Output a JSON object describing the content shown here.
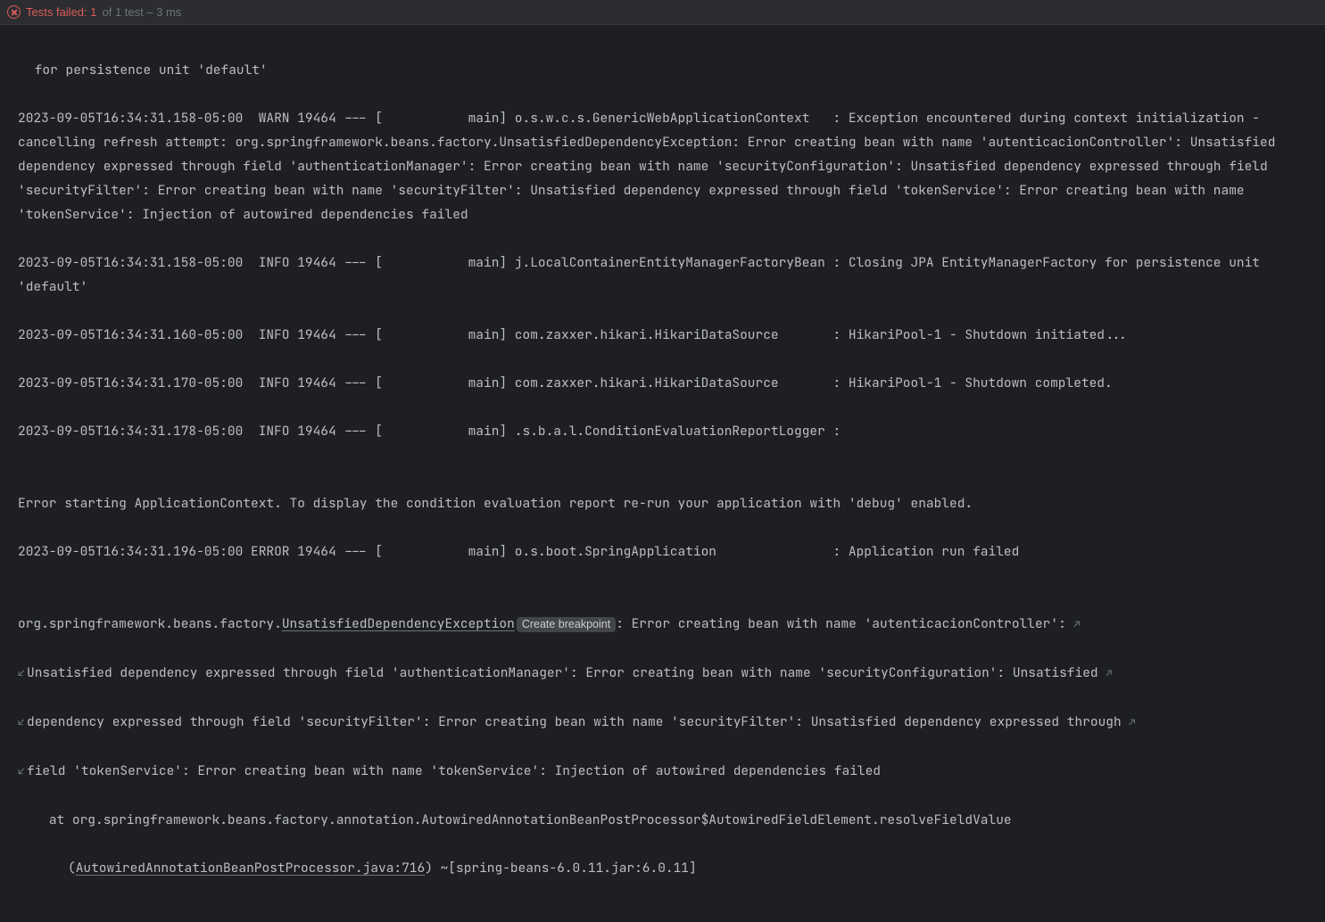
{
  "header": {
    "tests_failed_label": "Tests failed: 1",
    "tests_rest": " of 1 test – 3 ms"
  },
  "log": {
    "l0": " for persistence unit 'default'",
    "l1": "2023-09-05T16:34:31.158-05:00  WARN 19464 --- [           main] o.s.w.c.s.GenericWebApplicationContext   : Exception encountered during context initialization - cancelling refresh attempt: org.springframework.beans.factory.UnsatisfiedDependencyException: Error creating bean with name 'autenticacionController': Unsatisfied dependency expressed through field 'authenticationManager': Error creating bean with name 'securityConfiguration': Unsatisfied dependency expressed through field 'securityFilter': Error creating bean with name 'securityFilter': Unsatisfied dependency expressed through field 'tokenService': Error creating bean with name 'tokenService': Injection of autowired dependencies failed",
    "l2": "2023-09-05T16:34:31.158-05:00  INFO 19464 --- [           main] j.LocalContainerEntityManagerFactoryBean : Closing JPA EntityManagerFactory for persistence unit 'default'",
    "l3": "2023-09-05T16:34:31.160-05:00  INFO 19464 --- [           main] com.zaxxer.hikari.HikariDataSource       : HikariPool-1 - Shutdown initiated...",
    "l4": "2023-09-05T16:34:31.170-05:00  INFO 19464 --- [           main] com.zaxxer.hikari.HikariDataSource       : HikariPool-1 - Shutdown completed.",
    "l5": "2023-09-05T16:34:31.178-05:00  INFO 19464 --- [           main] .s.b.a.l.ConditionEvaluationReportLogger :",
    "l6": "",
    "l7": "Error starting ApplicationContext. To display the condition evaluation report re-run your application with 'debug' enabled.",
    "l8": "2023-09-05T16:34:31.196-05:00 ERROR 19464 --- [           main] o.s.boot.SpringApplication               : Application run failed",
    "l9": "",
    "ex_pkg": "org.springframework.beans.factory.",
    "ex_class": "UnsatisfiedDependencyException",
    "create_bp": "Create breakpoint",
    "ex_tail1": ": Error creating bean with name 'autenticacionController': ",
    "ex_tail2": "Unsatisfied dependency expressed through field 'authenticationManager': Error creating bean with name 'securityConfiguration': Unsatisfied ",
    "ex_tail3": "dependency expressed through field 'securityFilter': Error creating bean with name 'securityFilter': Unsatisfied dependency expressed through ",
    "ex_tail4": "field 'tokenService': Error creating bean with name 'tokenService': Injection of autowired dependencies failed",
    "at1": "    at org.springframework.beans.factory.annotation.AutowiredAnnotationBeanPostProcessor$AutowiredFieldElement.resolveFieldValue",
    "at2a": "(",
    "at2link": "AutowiredAnnotationBeanPostProcessor.java:716",
    "at2b": ") ~[spring-beans-6.0.11.jar:6.0.11]"
  },
  "glyphs": {
    "wrap_down": "↙",
    "wrap_up": "↗"
  }
}
